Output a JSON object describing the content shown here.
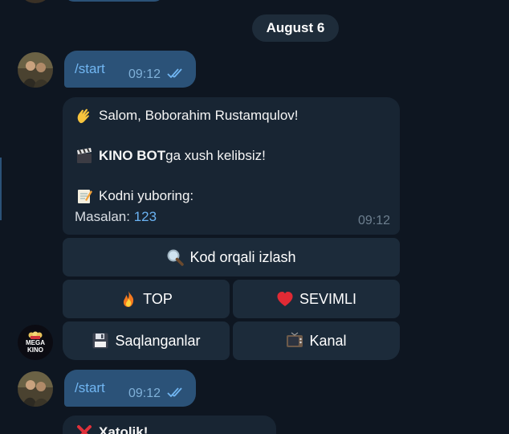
{
  "date_separator": "August 6",
  "messages": [
    {
      "command": "/start",
      "time": "09:12"
    },
    {
      "command": "/start",
      "time": "09:12"
    }
  ],
  "bot_reply": {
    "greeting": "Salom, Boborahim Rustamqulov!",
    "welcome_brand": "KINO BOT",
    "welcome_rest": "ga xush kelibsiz!",
    "prompt": "Kodni yuboring:",
    "example_label": "Masalan: ",
    "example_code": "123",
    "time": "09:12",
    "icons": [
      "waving-hand",
      "clapper-board",
      "memo"
    ]
  },
  "keyboard": {
    "search": "Kod orqali izlash",
    "top": "TOP",
    "favorites": "SEVIMLI",
    "saved": "Saqlanganlar",
    "channel": "Kanal",
    "icons": [
      "magnifier",
      "fire",
      "red-heart",
      "floppy-disk",
      "television"
    ]
  },
  "bot_avatar": {
    "line1": "MEGA",
    "line2": "KINO"
  },
  "error_message": {
    "text": "Xatolik!",
    "icon": "cross-mark"
  },
  "colors": {
    "background": "#0e1621",
    "outgoing_bubble": "#2b5278",
    "incoming_bubble": "#182533",
    "keyboard_button": "#1c2b3a",
    "link": "#6ab2f2"
  }
}
